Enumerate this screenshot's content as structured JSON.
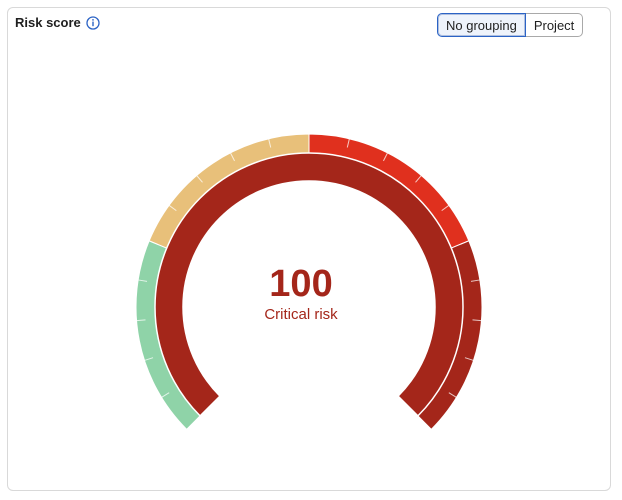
{
  "card": {
    "title": "Risk score",
    "info_icon": "info-circle-icon"
  },
  "grouping": {
    "options": [
      "No grouping",
      "Project"
    ],
    "selected": "No grouping"
  },
  "gauge": {
    "score": "100",
    "score_value": 100,
    "max": 100,
    "label": "Critical risk",
    "bands": [
      {
        "name": "low",
        "from": 0,
        "to": 25,
        "color": "#8fd3a8"
      },
      {
        "name": "medium",
        "from": 25,
        "to": 50,
        "color": "#e8c07a"
      },
      {
        "name": "high",
        "from": 50,
        "to": 75,
        "color": "#e0301e"
      },
      {
        "name": "critical",
        "from": 75,
        "to": 100,
        "color": "#a4261a"
      }
    ],
    "value_color": "#a4261a"
  }
}
